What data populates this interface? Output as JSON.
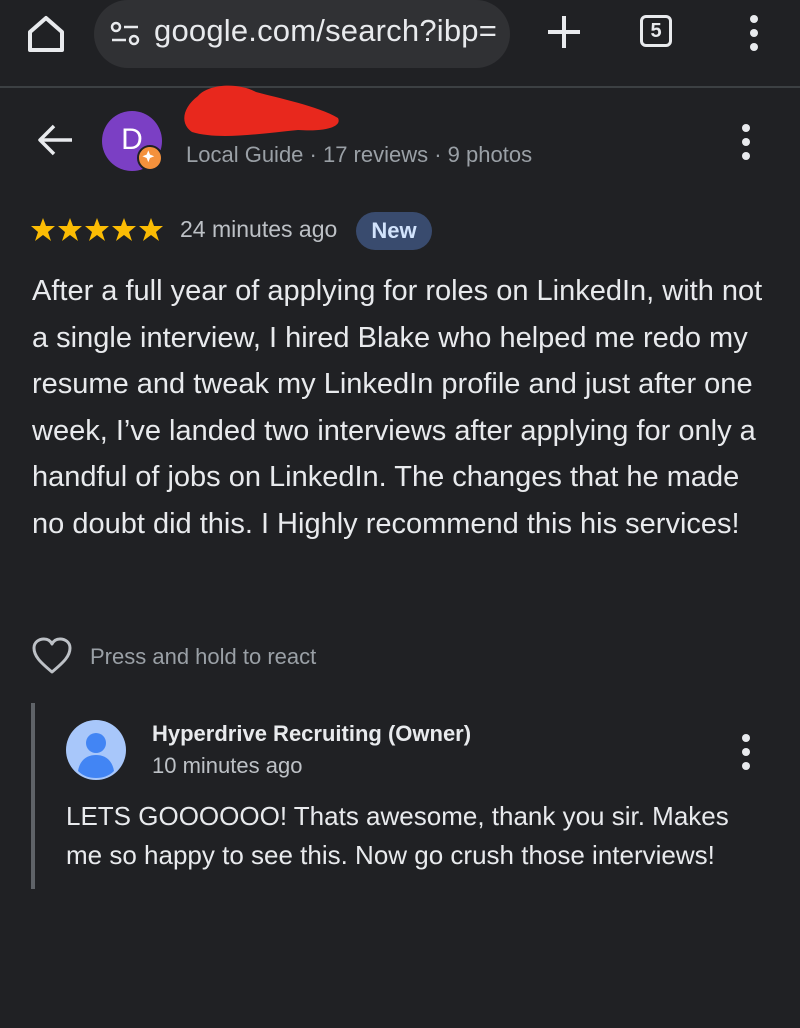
{
  "browser": {
    "url": "google.com/search?ibp=",
    "tab_count": "5",
    "icons": [
      "home-icon",
      "site-info-icon",
      "plus-icon",
      "tab-switcher-icon",
      "more-vert-icon"
    ]
  },
  "review": {
    "avatar_letter": "D",
    "reviewer_meta": "Local Guide · 17 reviews · 9 photos",
    "rating": 5,
    "time": "24 minutes ago",
    "badge": "New",
    "text": "After a full year of applying for roles on LinkedIn, with not a single interview, I hired Blake who helped me redo my resume and tweak my LinkedIn profile and just after one week, I’ve landed two interviews after applying for only a handful of jobs on LinkedIn. The changes that he made no doubt did this. I Highly recommend this his services!",
    "react_prompt": "Press and hold to react"
  },
  "owner_reply": {
    "name": "Hyperdrive Recruiting (Owner)",
    "time": "10 minutes ago",
    "text": "LETS GOOOOOO! Thats awesome, thank you sir. Makes me so happy to see this. Now go crush those interviews!"
  },
  "colors": {
    "background": "#202124",
    "star": "#fbbc04",
    "avatar": "#7b3fc4",
    "badge_bg": "#394b6e",
    "badge_text": "#d2e3fc",
    "redaction": "#e8281d"
  }
}
